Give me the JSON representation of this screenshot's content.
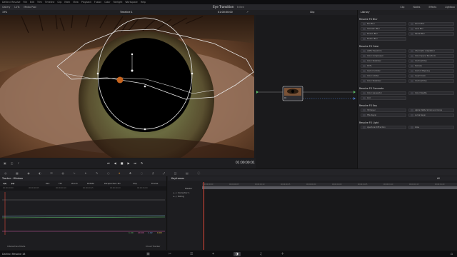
{
  "menubar": {
    "items": [
      "DaVinci Resolve",
      "File",
      "Edit",
      "Trim",
      "Timeline",
      "Clip",
      "Mark",
      "View",
      "Playback",
      "Fusion",
      "Color",
      "Fairlight",
      "Workspace",
      "Help"
    ]
  },
  "toolbar": {
    "left": [
      "Gallery",
      "LUTs",
      "Media Pool"
    ],
    "title": "Eye Transition",
    "title_status": "Edited",
    "right": [
      "Clip",
      "Nodes",
      "Effects",
      "Lightbox"
    ]
  },
  "viewer": {
    "zoom": "19%",
    "timeline_name": "Timeline 1",
    "timecode_top": "01:00:00:00",
    "timecode": "01:00:00:01"
  },
  "nodes": {
    "mode": "Clip",
    "node_label": "01"
  },
  "library": {
    "title": "Library",
    "sections": [
      {
        "title": "Resolve FX Blur",
        "items": [
          "Box Blur",
          "Gaussian Blur",
          "Lens Blur",
          "Mosaic Blur",
          "Radial Blur",
          "Zoom Blur",
          "Motion Blur"
        ]
      },
      {
        "title": "Resolve FX Color",
        "items": [
          "ACES Transform",
          "Chromatic Adaptation",
          "Color Compressor",
          "Color Space Transform",
          "Color Stabilizer",
          "Contrast Pop",
          "DCTL",
          "Dehaze",
          "Gamut Limiter",
          "Gamut Mapping",
          "Color Limiter",
          "Invert Color",
          "Color Stabilizer",
          "Contrast Pop"
        ]
      },
      {
        "title": "Resolve FX Generate",
        "items": [
          "Color Generator",
          "Color Palette",
          "Grid"
        ]
      },
      {
        "title": "Resolve FX Key",
        "items": [
          "3D Keyer",
          "Alpha Matte Shrink and Grow",
          "HSL Keyer",
          "Luma Keyer"
        ]
      },
      {
        "title": "Resolve FX Light",
        "items": [
          "Aperture Diffraction",
          "Glow"
        ]
      }
    ]
  },
  "tracker": {
    "title": "Tracker - Window",
    "options": [
      "Pan",
      "Tilt",
      "Zoom",
      "Rotate",
      "Perspective 3D",
      "Clip",
      "Frame"
    ],
    "scale": [
      "00:00:00:00",
      "00:00:00:05",
      "00:00:00:10",
      "00:00:00:15",
      "00:00:00:20",
      "00:00:01:00"
    ],
    "values": [
      "1.00",
      "20.06",
      "1.02",
      "0.00"
    ],
    "interactive_mode": "Interactive Mode",
    "cloud_tracker": "Cloud Tracker"
  },
  "keyframes": {
    "title": "Keyframes",
    "filter": "All",
    "master": "Master",
    "rows": [
      "Corrector 1",
      "Sizing"
    ],
    "ruler": [
      "00:00:00:00",
      "00:00:00:05",
      "00:00:00:10",
      "00:00:00:15",
      "00:00:00:20",
      "00:00:01:00",
      "00:00:01:05",
      "00:00:01:10",
      "00:00:01:15",
      "00:00:01:20"
    ]
  },
  "bottombar": {
    "app": "DaVinci Resolve 18"
  },
  "colors": {
    "accent": "#d48a2e",
    "playhead": "#e04a3a",
    "green": "#5fc06a",
    "pink": "#d45fa8"
  }
}
